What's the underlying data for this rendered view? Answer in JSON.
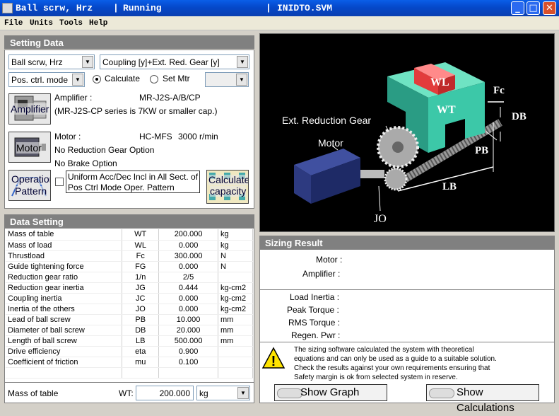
{
  "window": {
    "title_part1": "Ball scrw, Hrz",
    "sep1": "|",
    "status": "Running",
    "sep2": "|",
    "file": "INIDTO.SVM"
  },
  "menu": [
    "File",
    "Units",
    "Tools",
    "Help"
  ],
  "setting": {
    "header": "Setting Data",
    "machine": "Ball scrw, Hrz",
    "coupling": "Coupling [y]+Ext. Red. Gear [y]",
    "mode": "Pos. ctrl. mode",
    "calculate": "Calculate",
    "setmtr": "Set Mtr",
    "amp_btn": "Amplifier",
    "amp_label": "Amplifier :",
    "amp_value": "MR-J2S-A/B/CP",
    "amp_note": "(MR-J2S-CP series is 7KW or smaller cap.)",
    "motor_btn": "Motor",
    "motor_label": "Motor :",
    "motor_value": "HC-MFS",
    "motor_speed": "3000 r/min",
    "gear_opt": "No Reduction Gear Option",
    "brake_opt": "No Brake Option",
    "op_btn1": "Operation",
    "op_btn2": "Pattern",
    "uniform1": "Uniform Acc/Dec Incl in All Sect. of",
    "uniform2": "Pos Ctrl Mode Oper. Pattern",
    "calc_btn1": "Calculate",
    "calc_btn2": "capacity"
  },
  "data": {
    "header": "Data Setting",
    "rows": [
      [
        "Mass of table",
        "WT",
        "200.000",
        "kg"
      ],
      [
        "Mass of load",
        "WL",
        "0.000",
        "kg"
      ],
      [
        "Thrustload",
        "Fc",
        "300.000",
        "N"
      ],
      [
        "Guide tightening force",
        "FG",
        "0.000",
        "N"
      ],
      [
        "Reduction gear ratio",
        "1/n",
        "2/5",
        ""
      ],
      [
        "Reduction gear inertia",
        "JG",
        "0.444",
        "kg-cm2"
      ],
      [
        "Coupling inertia",
        "JC",
        "0.000",
        "kg-cm2"
      ],
      [
        "Inertia of the others",
        "JO",
        "0.000",
        "kg-cm2"
      ],
      [
        "Lead of ball screw",
        "PB",
        "10.000",
        "mm"
      ],
      [
        "Diameter of ball screw",
        "DB",
        "20.000",
        "mm"
      ],
      [
        "Length of ball screw",
        "LB",
        "500.000",
        "mm"
      ],
      [
        "Drive efficiency",
        "eta",
        "0.900",
        ""
      ],
      [
        "Coefficient of friction",
        "mu",
        "0.100",
        ""
      ],
      [
        "",
        "",
        "",
        ""
      ]
    ],
    "edit_label": "Mass of table",
    "edit_symbol": "WT:",
    "edit_value": "200.000",
    "edit_unit": "kg"
  },
  "diagram": {
    "wl": "WL",
    "wt": "WT",
    "fc": "Fc",
    "db": "DB",
    "pb": "PB",
    "lb": "LB",
    "jo": "JO",
    "motor": "Motor",
    "gear": "Ext. Reduction Gear"
  },
  "sizing": {
    "header": "Sizing Result",
    "motor": "Motor :",
    "amplifier": "Amplifier :",
    "load_inertia": "Load Inertia :",
    "peak_torque": "Peak Torque :",
    "rms_torque": "RMS Torque :",
    "regen": "Regen. Pwr :",
    "warning": [
      "The sizing software calculated the system with theoretical",
      "equations and can only be used as a guide to a suitable solution.",
      "Check the results against your own requirements ensuring that",
      "Safety margin is ok from selected system in reserve."
    ],
    "show_graph": "Show Graph",
    "show_calc": "Show Calculations"
  },
  "colors": {
    "title": "#0a52e0",
    "panel_header": "#808080",
    "diagram_bg": "#000000",
    "table_color": "#3cc8a8",
    "load_color": "#d83c3c"
  }
}
